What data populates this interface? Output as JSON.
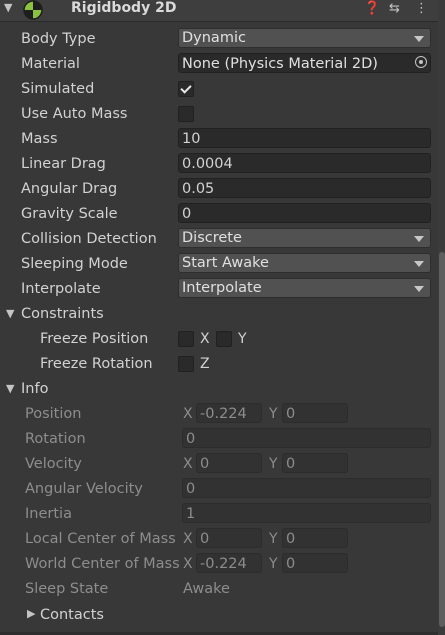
{
  "header": {
    "title": "Rigidbody 2D",
    "fold_icon": "triangle-down-icon",
    "component_icon": "physics-ball-icon",
    "help_icon": "help-icon",
    "presets_icon": "presets-icon",
    "menu_icon": "kebab-menu-icon",
    "help_glyph": "❓",
    "presets_glyph": "⇆",
    "menu_glyph": "⋮"
  },
  "properties": {
    "body_type": {
      "label": "Body Type",
      "value": "Dynamic"
    },
    "material": {
      "label": "Material",
      "value": "None (Physics Material 2D)"
    },
    "simulated": {
      "label": "Simulated",
      "checked": true
    },
    "use_auto_mass": {
      "label": "Use Auto Mass",
      "checked": false
    },
    "mass": {
      "label": "Mass",
      "value": "10"
    },
    "linear_drag": {
      "label": "Linear Drag",
      "value": "0.0004"
    },
    "angular_drag": {
      "label": "Angular Drag",
      "value": "0.05"
    },
    "gravity_scale": {
      "label": "Gravity Scale",
      "value": "0"
    },
    "collision_detection": {
      "label": "Collision Detection",
      "value": "Discrete"
    },
    "sleeping_mode": {
      "label": "Sleeping Mode",
      "value": "Start Awake"
    },
    "interpolate": {
      "label": "Interpolate",
      "value": "Interpolate"
    }
  },
  "constraints": {
    "label": "Constraints",
    "freeze_position": {
      "label": "Freeze Position",
      "x_label": "X",
      "y_label": "Y",
      "x": false,
      "y": false
    },
    "freeze_rotation": {
      "label": "Freeze Rotation",
      "z_label": "Z",
      "z": false
    }
  },
  "info": {
    "label": "Info",
    "position": {
      "label": "Position",
      "x_label": "X",
      "y_label": "Y",
      "x": "-0.224",
      "y": "0"
    },
    "rotation": {
      "label": "Rotation",
      "value": "0"
    },
    "velocity": {
      "label": "Velocity",
      "x_label": "X",
      "y_label": "Y",
      "x": "0",
      "y": "0"
    },
    "angular_velocity": {
      "label": "Angular Velocity",
      "value": "0"
    },
    "inertia": {
      "label": "Inertia",
      "value": "1"
    },
    "local_center_of_mass": {
      "label": "Local Center of Mass",
      "x_label": "X",
      "y_label": "Y",
      "x": "0",
      "y": "0"
    },
    "world_center_of_mass": {
      "label": "World Center of Mass",
      "x_label": "X",
      "y_label": "Y",
      "x": "-0.224",
      "y": "0"
    },
    "sleep_state": {
      "label": "Sleep State",
      "value": "Awake"
    },
    "contacts": {
      "label": "Contacts"
    }
  },
  "colors": {
    "panel_bg": "#383838",
    "field_bg": "#2a2a2a",
    "dropdown_bg": "#515151",
    "icon_green": "#8bc23f"
  }
}
